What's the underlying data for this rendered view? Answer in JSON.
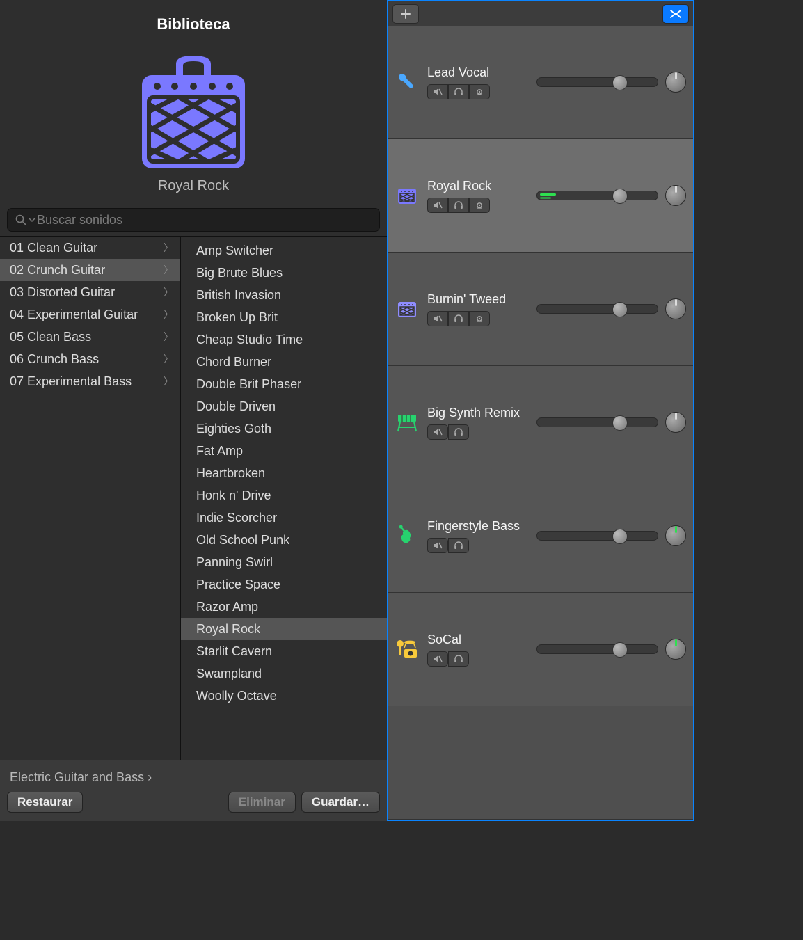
{
  "library": {
    "title": "Biblioteca",
    "preset_name": "Royal Rock",
    "search_placeholder": "Buscar sonidos",
    "breadcrumb": "Electric Guitar and Bass  ›",
    "buttons": {
      "restore": "Restaurar",
      "delete": "Eliminar",
      "save": "Guardar…"
    },
    "categories": [
      {
        "label": "01 Clean Guitar",
        "selected": false
      },
      {
        "label": "02 Crunch Guitar",
        "selected": true
      },
      {
        "label": "03 Distorted Guitar",
        "selected": false
      },
      {
        "label": "04 Experimental Guitar",
        "selected": false
      },
      {
        "label": "05 Clean Bass",
        "selected": false
      },
      {
        "label": "06 Crunch Bass",
        "selected": false
      },
      {
        "label": "07 Experimental Bass",
        "selected": false
      }
    ],
    "presets": [
      {
        "label": "Amp Switcher",
        "selected": false
      },
      {
        "label": "Big Brute Blues",
        "selected": false
      },
      {
        "label": "British Invasion",
        "selected": false
      },
      {
        "label": "Broken Up Brit",
        "selected": false
      },
      {
        "label": "Cheap Studio Time",
        "selected": false
      },
      {
        "label": "Chord Burner",
        "selected": false
      },
      {
        "label": "Double Brit Phaser",
        "selected": false
      },
      {
        "label": "Double Driven",
        "selected": false
      },
      {
        "label": "Eighties Goth",
        "selected": false
      },
      {
        "label": "Fat Amp",
        "selected": false
      },
      {
        "label": "Heartbroken",
        "selected": false
      },
      {
        "label": "Honk n' Drive",
        "selected": false
      },
      {
        "label": "Indie Scorcher",
        "selected": false
      },
      {
        "label": "Old School Punk",
        "selected": false
      },
      {
        "label": "Panning Swirl",
        "selected": false
      },
      {
        "label": "Practice Space",
        "selected": false
      },
      {
        "label": "Razor Amp",
        "selected": false
      },
      {
        "label": "Royal Rock",
        "selected": true
      },
      {
        "label": "Starlit Cavern",
        "selected": false
      },
      {
        "label": "Swampland",
        "selected": false
      },
      {
        "label": "Woolly Octave",
        "selected": false
      }
    ]
  },
  "tracks": [
    {
      "name": "Lead Vocal",
      "icon": "mic",
      "color": "#4aa8ff",
      "has_record": true,
      "selected": false,
      "vol": 0.68,
      "level": 0,
      "knob_green": false
    },
    {
      "name": "Royal Rock",
      "icon": "amp",
      "color": "#7a78ff",
      "has_record": true,
      "selected": true,
      "vol": 0.68,
      "level": 0.13,
      "knob_green": false
    },
    {
      "name": "Burnin' Tweed",
      "icon": "amp",
      "color": "#8f8dff",
      "has_record": true,
      "selected": false,
      "vol": 0.68,
      "level": 0,
      "knob_green": false
    },
    {
      "name": "Big Synth Remix",
      "icon": "keys",
      "color": "#27d36e",
      "has_record": false,
      "selected": false,
      "vol": 0.68,
      "level": 0,
      "knob_green": false
    },
    {
      "name": "Fingerstyle Bass",
      "icon": "guitar",
      "color": "#27d36e",
      "has_record": false,
      "selected": false,
      "vol": 0.68,
      "level": 0,
      "knob_green": true
    },
    {
      "name": "SoCal",
      "icon": "drums",
      "color": "#f7c93b",
      "has_record": false,
      "selected": false,
      "vol": 0.68,
      "level": 0,
      "knob_green": true
    }
  ]
}
